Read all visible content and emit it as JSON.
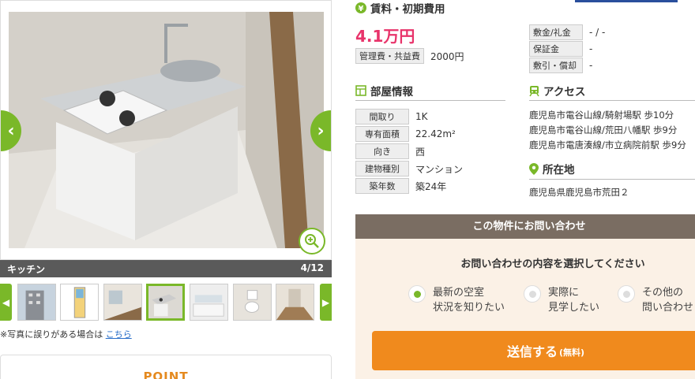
{
  "gallery": {
    "caption": "キッチン",
    "counter": "4/12",
    "report_text": "※写真に誤りがある場合は",
    "report_link": "こちら"
  },
  "point": {
    "label": "POINT"
  },
  "fees": {
    "heading": "賃料・初期費用",
    "rent": "4.1万円",
    "mgmt_label": "管理費・共益費",
    "mgmt_value": "2000円",
    "deposit_label": "敷金/礼金",
    "deposit_value": "- / -",
    "guarantee_label": "保証金",
    "guarantee_value": "-",
    "keymoney_label": "敷引・償却",
    "keymoney_value": "-"
  },
  "room": {
    "heading": "部屋情報",
    "rows": [
      {
        "label": "間取り",
        "value": "1K"
      },
      {
        "label": "専有面積",
        "value": "22.42m²"
      },
      {
        "label": "向き",
        "value": "西"
      },
      {
        "label": "建物種別",
        "value": "マンション"
      },
      {
        "label": "築年数",
        "value": "築24年"
      }
    ]
  },
  "access": {
    "heading": "アクセス",
    "lines": [
      "鹿児島市電谷山線/騎射場駅 歩10分",
      "鹿児島市電谷山線/荒田八幡駅 歩9分",
      "鹿児島市電唐湊線/市立病院前駅 歩9分"
    ]
  },
  "location": {
    "heading": "所在地",
    "address": "鹿児島県鹿児島市荒田２"
  },
  "contact": {
    "title": "この物件にお問い合わせ",
    "question": "お問い合わせの内容を選択してください",
    "options": [
      {
        "line1": "最新の空室",
        "line2": "状況を知りたい",
        "selected": true
      },
      {
        "line1": "実際に",
        "line2": "見学したい",
        "selected": false
      },
      {
        "line1": "その他の",
        "line2": "問い合わせ",
        "selected": false
      }
    ],
    "submit": "送信する",
    "submit_note": "(無料)"
  },
  "colors": {
    "accent_green": "#7ab829",
    "price_pink": "#e8336a",
    "submit_orange": "#f08a1d",
    "contact_header": "#7a6d62"
  }
}
